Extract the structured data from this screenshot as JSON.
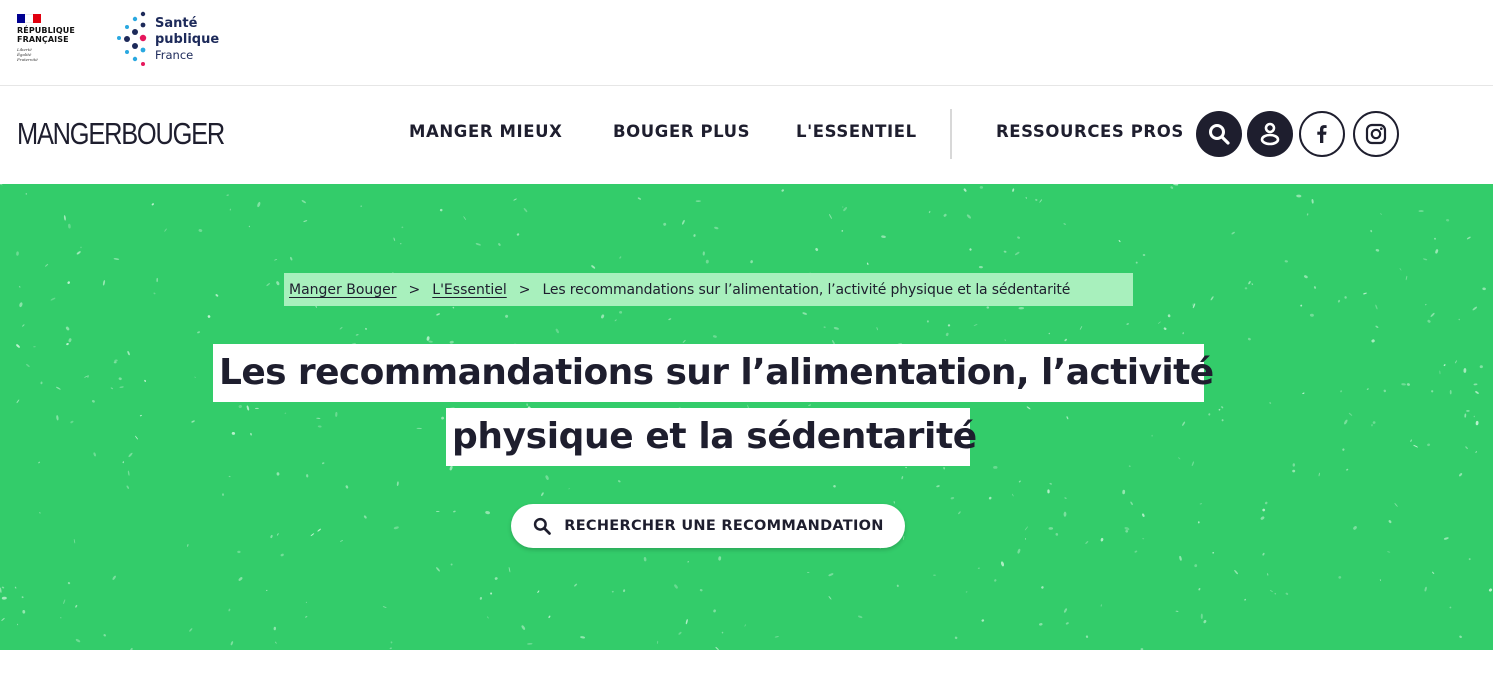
{
  "gov": {
    "line1": "RÉPUBLIQUE",
    "line2": "FRANÇAISE",
    "motto1": "Liberté",
    "motto2": "Égalité",
    "motto3": "Fraternité"
  },
  "spf": {
    "line1": "Santé",
    "line2": "publique",
    "line3": "France"
  },
  "header": {
    "brand": "MANGERBOUGER",
    "nav": [
      "MANGER MIEUX",
      "BOUGER PLUS",
      "L'ESSENTIEL",
      "RESSOURCES PROS"
    ],
    "icons": [
      "search-icon",
      "user-icon",
      "facebook-icon",
      "instagram-icon"
    ]
  },
  "breadcrumb": {
    "items": [
      "Manger Bouger",
      "L'Essentiel"
    ],
    "separator": ">",
    "current": "Les recommandations sur l’alimentation, l’activité physique et la sédentarité"
  },
  "hero": {
    "title_line1": "Les recommandations sur l’alimentation, l’activité",
    "title_line2": "physique et la sédentarité",
    "cta_label": "RECHERCHER UNE RECOMMANDATION"
  },
  "colors": {
    "hero_green": "#33cc6a",
    "breadcrumb_bg": "#a8f0bd",
    "dark": "#1e1e2e"
  }
}
